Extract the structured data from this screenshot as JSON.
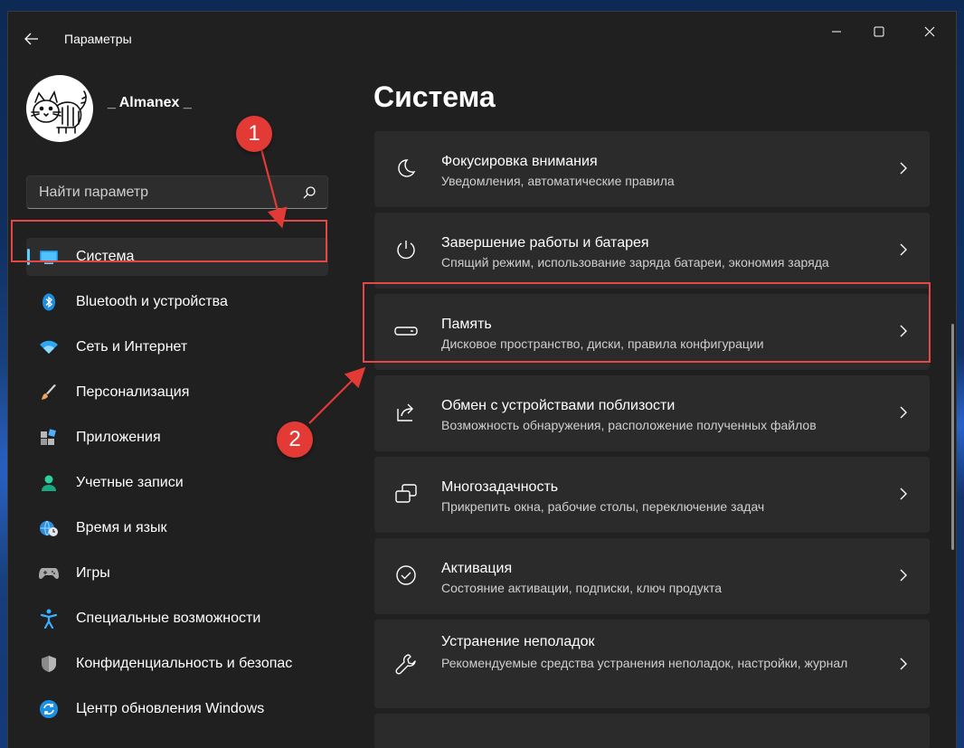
{
  "window": {
    "title": "Параметры"
  },
  "user": {
    "name": "_ Almanex _"
  },
  "search": {
    "placeholder": "Найти параметр"
  },
  "nav": {
    "items": [
      {
        "label": "Система"
      },
      {
        "label": "Bluetooth и устройства"
      },
      {
        "label": "Сеть и Интернет"
      },
      {
        "label": "Персонализация"
      },
      {
        "label": "Приложения"
      },
      {
        "label": "Учетные записи"
      },
      {
        "label": "Время и язык"
      },
      {
        "label": "Игры"
      },
      {
        "label": "Специальные возможности"
      },
      {
        "label": "Конфиденциальность и безопас"
      },
      {
        "label": "Центр обновления Windows"
      }
    ]
  },
  "main": {
    "title": "Система",
    "cards": [
      {
        "title": "Фокусировка внимания",
        "subtitle": "Уведомления, автоматические правила"
      },
      {
        "title": "Завершение работы и батарея",
        "subtitle": "Спящий режим, использование заряда батареи, экономия заряда"
      },
      {
        "title": "Память",
        "subtitle": "Дисковое пространство, диски, правила конфигурации"
      },
      {
        "title": "Обмен с устройствами поблизости",
        "subtitle": "Возможность обнаружения, расположение полученных файлов"
      },
      {
        "title": "Многозадачность",
        "subtitle": "Прикрепить окна, рабочие столы, переключение задач"
      },
      {
        "title": "Активация",
        "subtitle": "Состояние активации, подписки, ключ продукта"
      },
      {
        "title": "Устранение неполадок",
        "subtitle": "Рекомендуемые средства устранения неполадок, настройки, журнал"
      }
    ]
  },
  "annotations": {
    "badge_1": "1",
    "badge_2": "2"
  },
  "colors": {
    "accent": "#60cdff",
    "annotation_red": "#e33a36",
    "window_bg": "#202020",
    "card_bg": "#2b2b2b"
  }
}
